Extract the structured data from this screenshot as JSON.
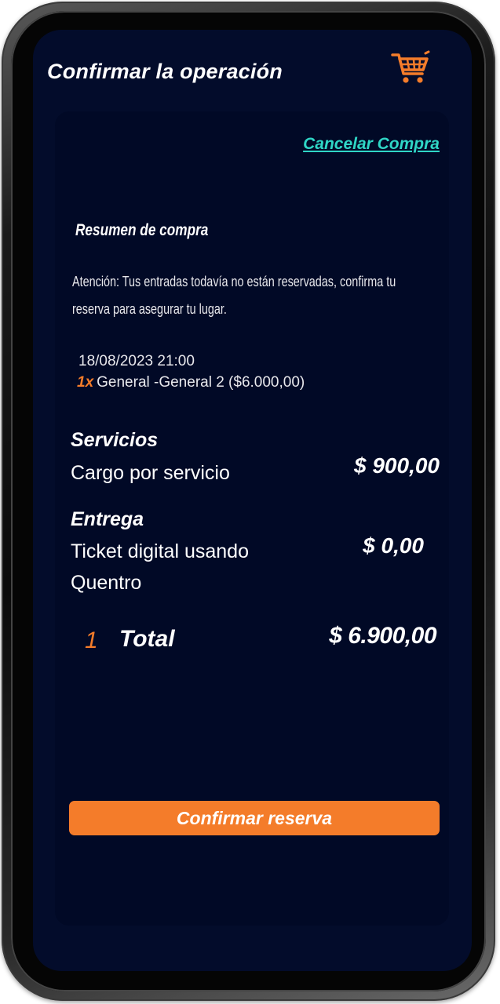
{
  "header": {
    "title": "Confirmar la operación",
    "cart_icon": "shopping-cart-icon",
    "cart_color": "#f47c2a"
  },
  "card": {
    "cancel_label": "Cancelar Compra",
    "summary_title": "Resumen de compra",
    "notice": "Atención: Tus entradas todavía no están reservadas, confirma tu reserva para asegurar tu lugar.",
    "event_datetime": "18/08/2023 21:00",
    "ticket": {
      "quantity": "1x",
      "description": "General -General 2 ($6.000,00)"
    },
    "services": {
      "heading": "Servicios",
      "label": "Cargo por servicio",
      "amount": "$ 900,00"
    },
    "delivery": {
      "heading": "Entrega",
      "label": "Ticket digital usando Quentro",
      "amount": "$ 0,00"
    },
    "total": {
      "count": "1",
      "label": "Total",
      "amount": "$ 6.900,00"
    },
    "confirm_label": "Confirmar reserva"
  },
  "colors": {
    "background": "#030c2b",
    "card": "#010926",
    "accent": "#f47c2a",
    "link": "#2fd6c6"
  }
}
